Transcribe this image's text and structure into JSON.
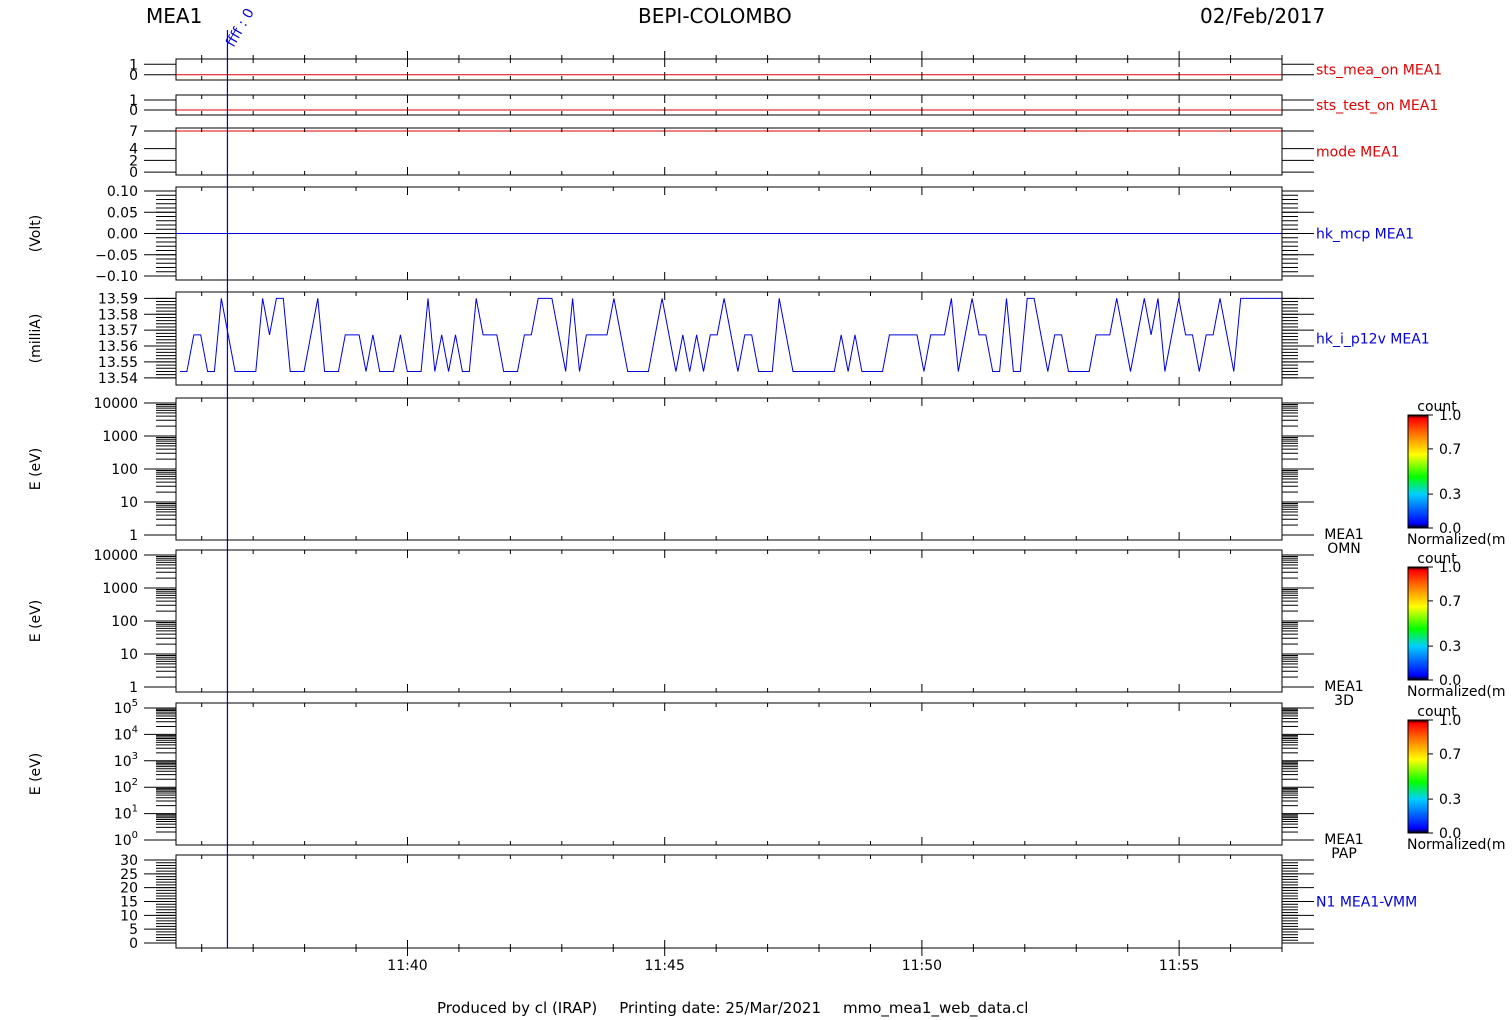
{
  "header": {
    "left": "MEA1",
    "center": "BEPI-COLOMBO",
    "right": "02/Feb/2017"
  },
  "marker_label": "ffff : 0",
  "footer": {
    "produced_by": "Produced by cl (IRAP)",
    "printing_date": "Printing date: 25/Mar/2021",
    "script": "mmo_mea1_web_data.cl"
  },
  "colors": {
    "red": "#e00000",
    "blue": "#0000dd",
    "axis": "#000000"
  },
  "chart_data": {
    "type": "line",
    "x_axis": {
      "range": [
        "11:35:30",
        "11:57:00"
      ],
      "major_ticks": [
        "11:40",
        "11:45",
        "11:50",
        "11:55"
      ]
    },
    "marker_time": "11:36:30",
    "panels": [
      {
        "id": "sts_mea_on",
        "label": "sts_mea_on MEA1",
        "label_color": "#e00000",
        "ylabel": "",
        "ticks": [
          "1",
          "0"
        ],
        "ylim": [
          -0.5,
          1.5
        ],
        "line_value": 0
      },
      {
        "id": "sts_test_on",
        "label": "sts_test_on MEA1",
        "label_color": "#e00000",
        "ylabel": "",
        "ticks": [
          "1",
          "0"
        ],
        "ylim": [
          -0.5,
          1.5
        ],
        "line_value": 0
      },
      {
        "id": "mode",
        "label": "mode MEA1",
        "label_color": "#e00000",
        "ylabel": "",
        "ticks": [
          "7",
          "4",
          "2",
          "0"
        ],
        "ylim": [
          -0.5,
          7.5
        ],
        "line_value": 7
      },
      {
        "id": "hk_mcp",
        "label": "hk_mcp MEA1",
        "label_color": "#0000dd",
        "ylabel": "(Volt)",
        "ticks": [
          "0.10",
          "0.05",
          "0.00",
          "−0.05",
          "−0.10"
        ],
        "ylim": [
          -0.1,
          0.1
        ],
        "line_value": 0
      },
      {
        "id": "hk_i_p12v",
        "label": "hk_i_p12v MEA1",
        "label_color": "#0000dd",
        "ylabel": "(milliA)",
        "ticks": [
          "13.59",
          "13.58",
          "13.57",
          "13.56",
          "13.55",
          "13.54"
        ],
        "ylim": [
          13.538,
          13.5915
        ],
        "values": [
          13.544,
          13.544,
          13.567,
          13.567,
          13.544,
          13.544,
          13.59,
          13.567,
          13.544,
          13.544,
          13.544,
          13.544,
          13.59,
          13.567,
          13.59,
          13.59,
          13.544,
          13.544,
          13.544,
          13.567,
          13.59,
          13.544,
          13.544,
          13.544,
          13.567,
          13.567,
          13.567,
          13.544,
          13.567,
          13.544,
          13.544,
          13.544,
          13.567,
          13.544,
          13.544,
          13.544,
          13.59,
          13.544,
          13.567,
          13.544,
          13.567,
          13.544,
          13.544,
          13.59,
          13.567,
          13.567,
          13.567,
          13.544,
          13.544,
          13.544,
          13.567,
          13.567,
          13.59,
          13.59,
          13.59,
          13.567,
          13.544,
          13.59,
          13.544,
          13.567,
          13.567,
          13.567,
          13.567,
          13.59,
          13.567,
          13.544,
          13.544,
          13.544,
          13.544,
          13.567,
          13.59,
          13.567,
          13.544,
          13.567,
          13.544,
          13.567,
          13.544,
          13.567,
          13.567,
          13.59,
          13.567,
          13.544,
          13.567,
          13.567,
          13.544,
          13.544,
          13.544,
          13.59,
          13.567,
          13.544,
          13.544,
          13.544,
          13.544,
          13.544,
          13.544,
          13.544,
          13.567,
          13.544,
          13.567,
          13.544,
          13.544,
          13.544,
          13.544,
          13.567,
          13.567,
          13.567,
          13.567,
          13.567,
          13.544,
          13.567,
          13.567,
          13.567,
          13.59,
          13.544,
          13.567,
          13.59,
          13.567,
          13.567,
          13.544,
          13.544,
          13.59,
          13.544,
          13.544,
          13.59,
          13.59,
          13.567,
          13.544,
          13.567,
          13.567,
          13.544,
          13.544,
          13.544,
          13.544,
          13.567,
          13.567,
          13.567,
          13.59,
          13.567,
          13.544,
          13.567,
          13.59,
          13.567,
          13.59,
          13.544,
          13.567,
          13.59,
          13.567,
          13.567,
          13.544,
          13.567,
          13.567,
          13.59,
          13.567,
          13.544,
          13.59,
          13.59,
          13.59,
          13.59,
          13.59,
          13.59,
          13.59
        ]
      },
      {
        "id": "omn",
        "label": "MEA1",
        "label2": "OMN",
        "label_color": "#000000",
        "ylabel": "E (eV)",
        "ticks": [
          "10000",
          "1000",
          "100",
          "10",
          "1"
        ],
        "yscale": "log",
        "ylim": [
          1,
          10000
        ]
      },
      {
        "id": "3d",
        "label": "MEA1",
        "label2": "3D",
        "label_color": "#000000",
        "ylabel": "E (eV)",
        "ticks": [
          "10000",
          "1000",
          "100",
          "10",
          "1"
        ],
        "yscale": "log",
        "ylim": [
          1,
          10000
        ]
      },
      {
        "id": "pap",
        "label": "MEA1",
        "label2": "PAP",
        "label_color": "#000000",
        "ylabel": "E (eV)",
        "ticks_base": "10",
        "ticks_exp": [
          "5",
          "4",
          "3",
          "2",
          "1",
          "0"
        ],
        "yscale": "log",
        "ylim": [
          1,
          100000
        ]
      },
      {
        "id": "n1_vmm",
        "label": "N1 MEA1-VMM",
        "label_color": "#0000dd",
        "ylabel": "",
        "ticks": [
          "30",
          "25",
          "20",
          "15",
          "10",
          "5",
          "0"
        ],
        "ylim": [
          0,
          30
        ]
      }
    ],
    "colorbars": [
      {
        "title": "count",
        "ticks": [
          "1.0",
          "0.7",
          "0.3",
          "0.0"
        ],
        "caption": "Normalized(m"
      },
      {
        "title": "count",
        "ticks": [
          "1.0",
          "0.7",
          "0.3",
          "0.0"
        ],
        "caption": "Normalized(m"
      },
      {
        "title": "count",
        "ticks": [
          "1.0",
          "0.7",
          "0.3",
          "0.0"
        ],
        "caption": "Normalized(m"
      }
    ]
  }
}
